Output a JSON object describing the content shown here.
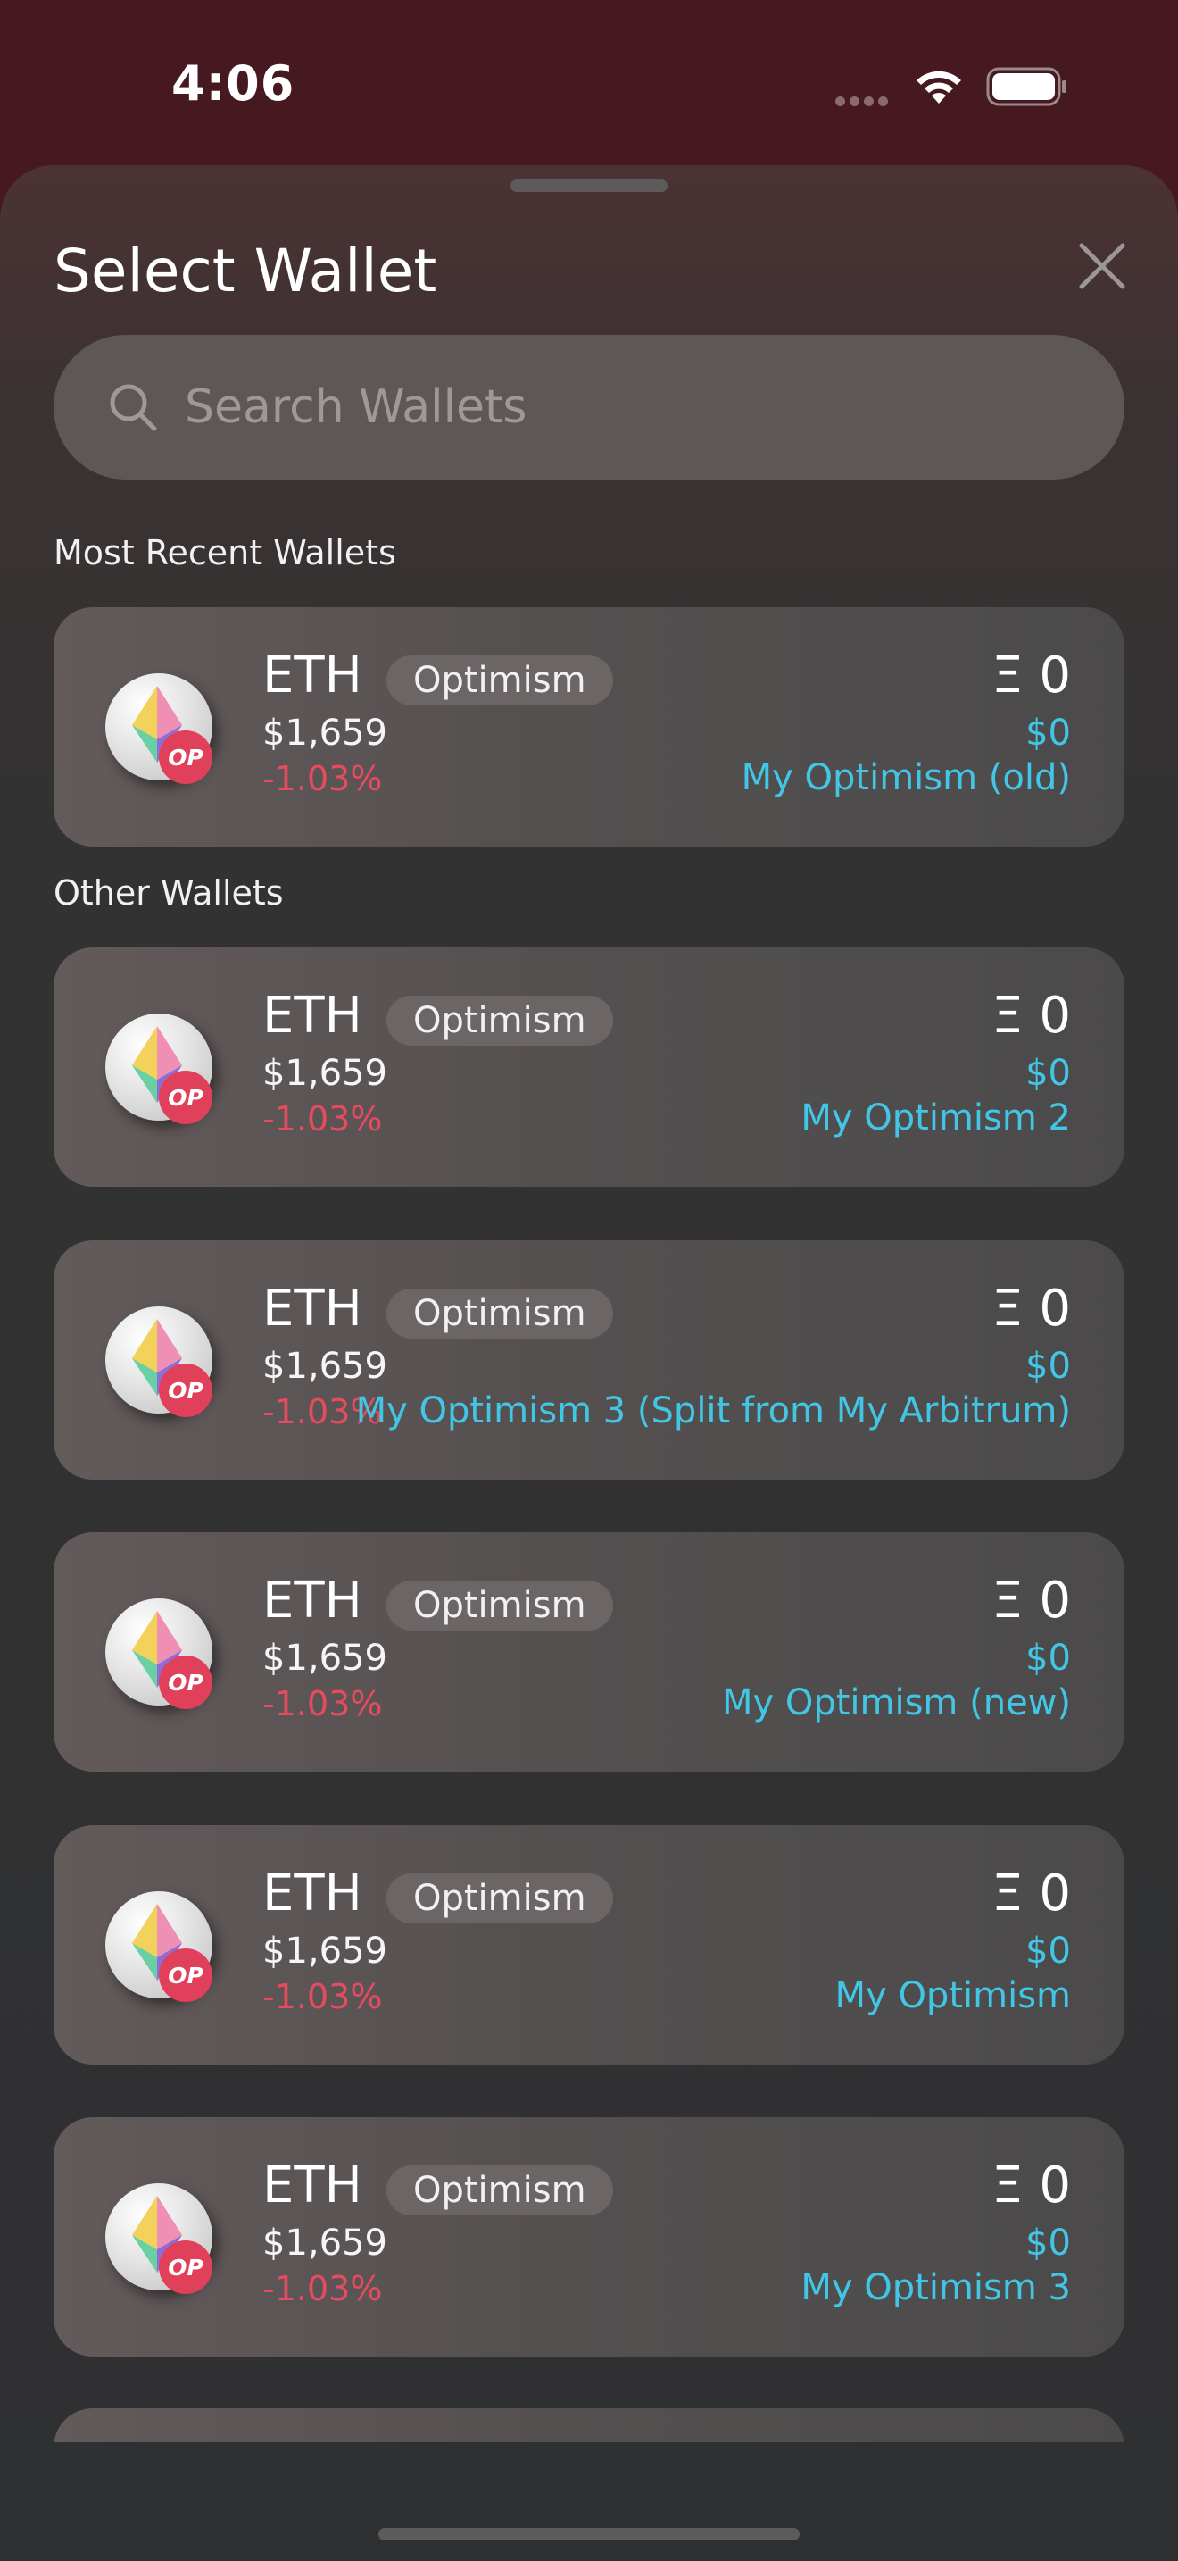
{
  "status_bar": {
    "time": "4:06"
  },
  "sheet": {
    "title": "Select Wallet",
    "search": {
      "placeholder": "Search Wallets",
      "value": ""
    }
  },
  "sections": {
    "recent_label": "Most Recent Wallets",
    "other_label": "Other Wallets"
  },
  "wallets": [
    {
      "ticker": "ETH",
      "network": "Optimism",
      "price": "$1,659",
      "change": "-1.03%",
      "balance": "Ξ 0",
      "fiat": "$0",
      "name": "My Optimism (old)",
      "badge": "OP"
    },
    {
      "ticker": "ETH",
      "network": "Optimism",
      "price": "$1,659",
      "change": "-1.03%",
      "balance": "Ξ 0",
      "fiat": "$0",
      "name": "My Optimism 2",
      "badge": "OP"
    },
    {
      "ticker": "ETH",
      "network": "Optimism",
      "price": "$1,659",
      "change": "-1.03%",
      "balance": "Ξ 0",
      "fiat": "$0",
      "name": "My Optimism 3 (Split from My Arbitrum)",
      "badge": "OP"
    },
    {
      "ticker": "ETH",
      "network": "Optimism",
      "price": "$1,659",
      "change": "-1.03%",
      "balance": "Ξ 0",
      "fiat": "$0",
      "name": "My Optimism (new)",
      "badge": "OP"
    },
    {
      "ticker": "ETH",
      "network": "Optimism",
      "price": "$1,659",
      "change": "-1.03%",
      "balance": "Ξ 0",
      "fiat": "$0",
      "name": "My Optimism",
      "badge": "OP"
    },
    {
      "ticker": "ETH",
      "network": "Optimism",
      "price": "$1,659",
      "change": "-1.03%",
      "balance": "Ξ 0",
      "fiat": "$0",
      "name": "My Optimism 3",
      "badge": "OP"
    }
  ],
  "colors": {
    "background_top": "#461820",
    "accent_cyan": "#41c6e6",
    "negative_red": "#e64b5f",
    "badge_red": "#e0405a"
  },
  "icons": [
    "search-icon",
    "close-icon",
    "wifi-icon",
    "battery-icon",
    "cellular-signal-icon",
    "eth-logo-icon",
    "optimism-badge-icon"
  ]
}
